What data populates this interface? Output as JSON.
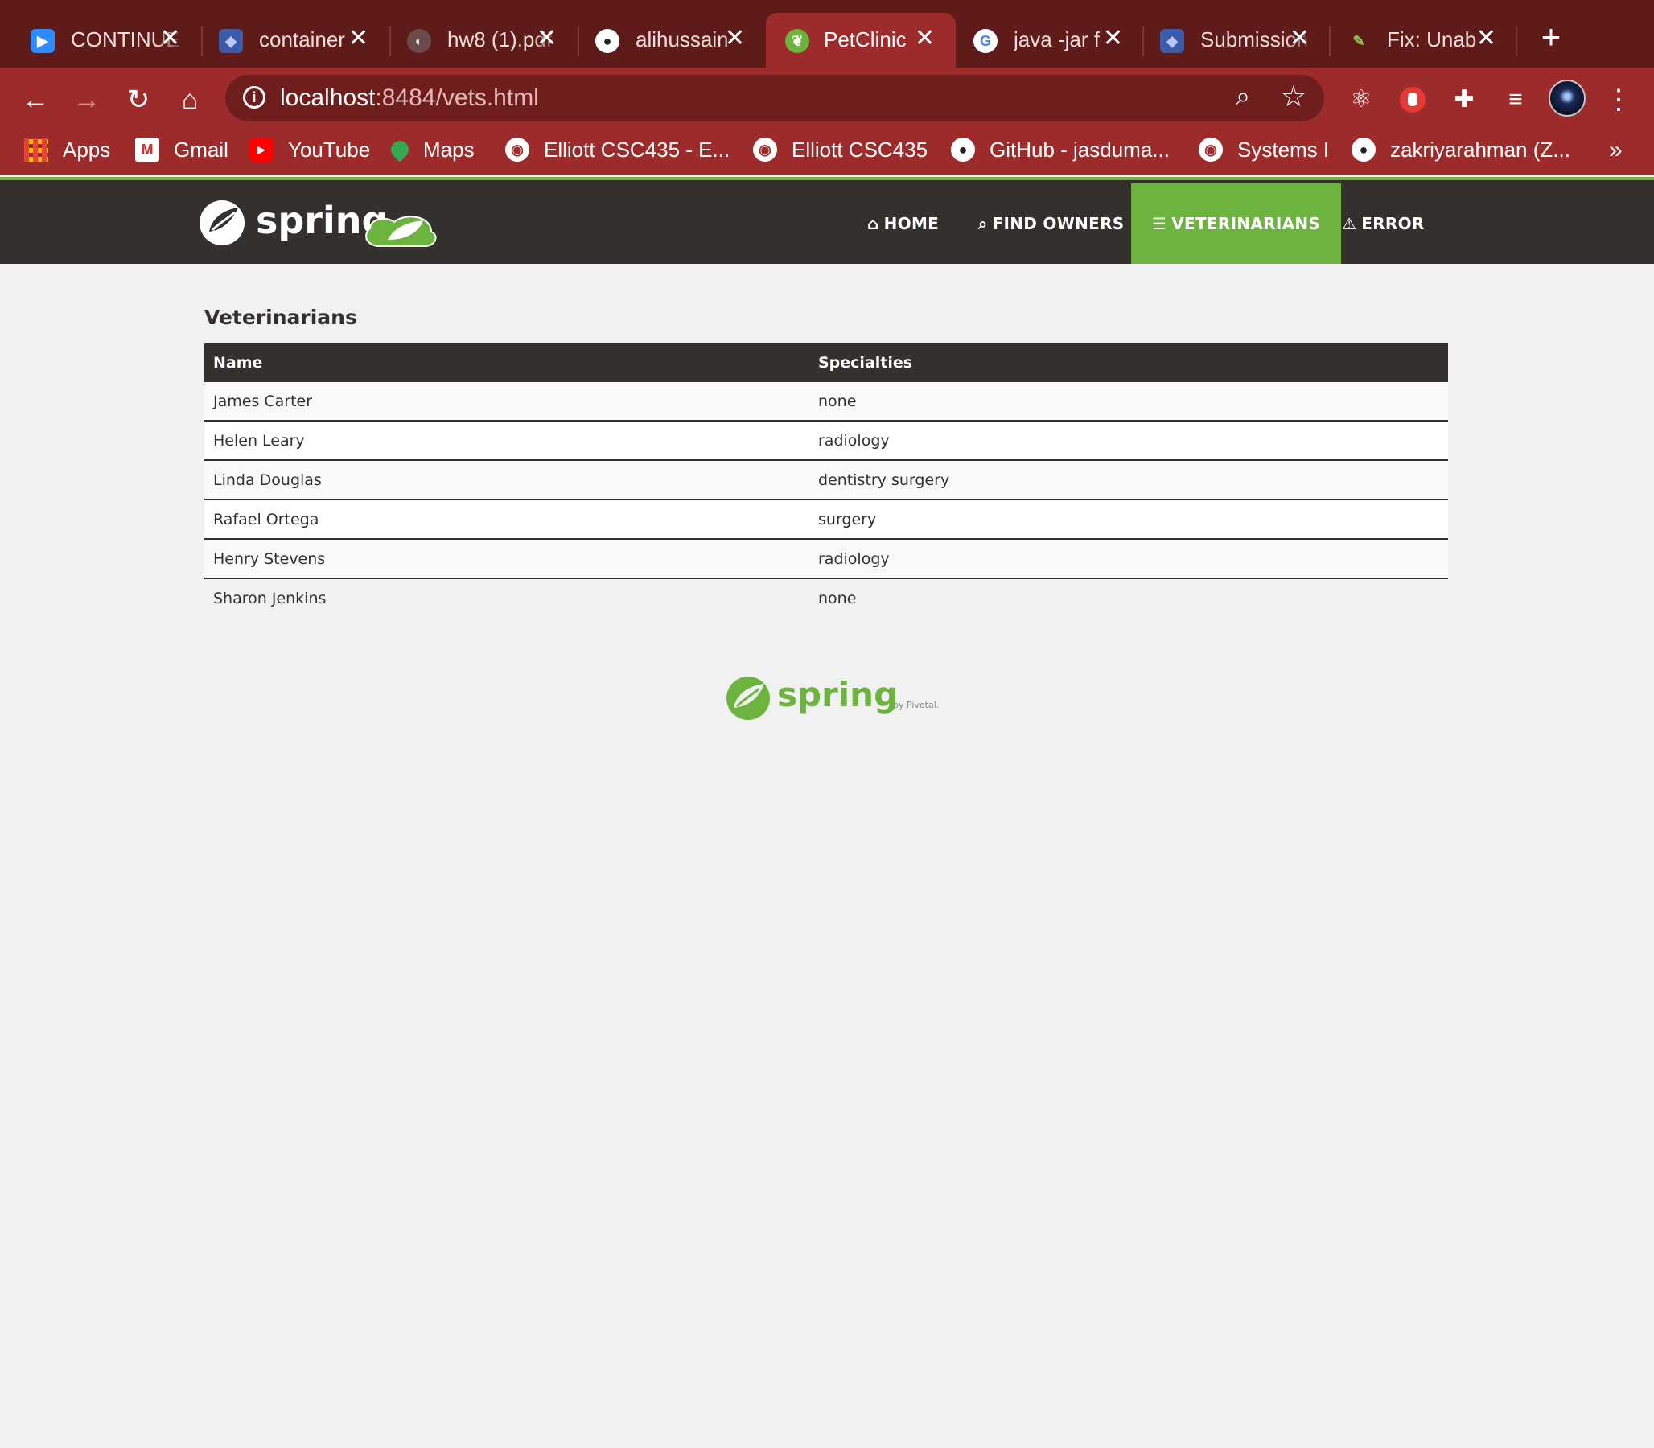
{
  "browser": {
    "tabs": [
      {
        "title": "CONTINUE",
        "favicon": "zoom-icon",
        "active": false
      },
      {
        "title": "container",
        "favicon": "cube-icon",
        "active": false
      },
      {
        "title": "hw8 (1).pdf",
        "favicon": "globe-icon",
        "active": false
      },
      {
        "title": "alihussain",
        "favicon": "github-icon",
        "active": false
      },
      {
        "title": "PetClinic",
        "favicon": "spring-leaf-icon",
        "active": true
      },
      {
        "title": "java -jar f",
        "favicon": "google-icon",
        "active": false
      },
      {
        "title": "Submission",
        "favicon": "cube-icon",
        "active": false
      },
      {
        "title": "Fix: Unab",
        "favicon": "feather-icon",
        "active": false
      }
    ],
    "url_host": "localhost",
    "url_rest": ":8484/vets.html",
    "bookmarks": [
      {
        "label": "Apps",
        "icon": "apps-grid-icon"
      },
      {
        "label": "Gmail",
        "icon": "gmail-icon"
      },
      {
        "label": "YouTube",
        "icon": "youtube-icon"
      },
      {
        "label": "Maps",
        "icon": "maps-pin-icon"
      },
      {
        "label": "Elliott CSC435 - E...",
        "icon": "globe-icon"
      },
      {
        "label": "Elliott CSC435",
        "icon": "globe-icon"
      },
      {
        "label": "GitHub - jasduma...",
        "icon": "github-icon"
      },
      {
        "label": "Systems I",
        "icon": "globe-icon"
      },
      {
        "label": "zakriyarahman (Z...",
        "icon": "github-icon"
      }
    ],
    "bookmarks_overflow": "»"
  },
  "nav": {
    "home": "HOME",
    "find_owners": "FIND OWNERS",
    "veterinarians": "VETERINARIANS",
    "error": "ERROR"
  },
  "brand": {
    "logo_text": "spring",
    "footer_logo_text": "spring",
    "footer_by": "by Pivotal."
  },
  "page": {
    "title": "Veterinarians",
    "columns": [
      "Name",
      "Specialties"
    ],
    "rows": [
      {
        "name": "James Carter",
        "specialties": "none"
      },
      {
        "name": "Helen Leary",
        "specialties": "radiology"
      },
      {
        "name": "Linda Douglas",
        "specialties": "dentistry surgery"
      },
      {
        "name": "Rafael Ortega",
        "specialties": "surgery"
      },
      {
        "name": "Henry Stevens",
        "specialties": "radiology"
      },
      {
        "name": "Sharon Jenkins",
        "specialties": "none"
      }
    ]
  },
  "colors": {
    "chrome_dark": "#5f1a1a",
    "chrome": "#9e2b2b",
    "navbar": "#34302d",
    "spring_green": "#6db33f"
  }
}
